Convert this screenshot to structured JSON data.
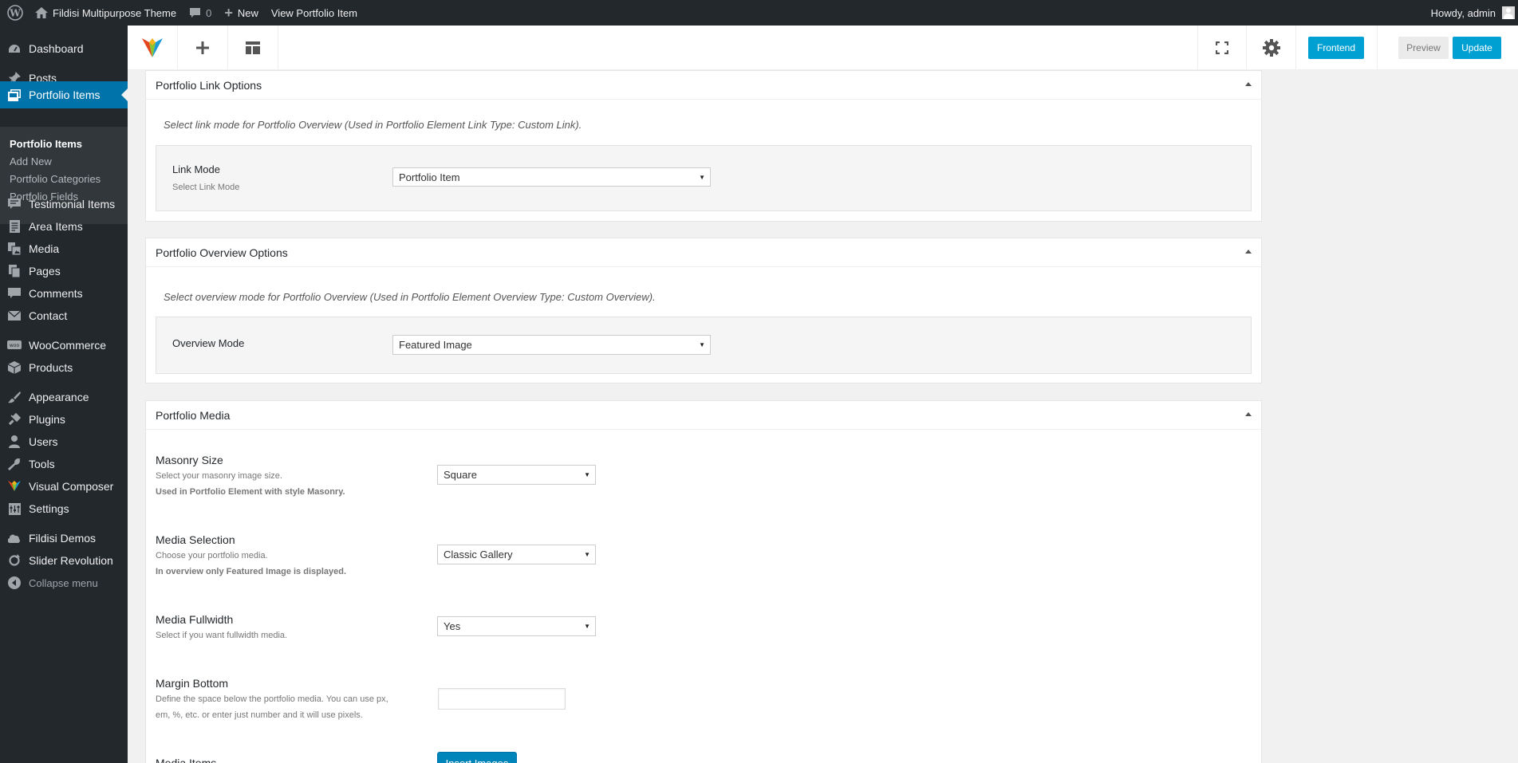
{
  "adminbar": {
    "site_name": "Fildisi Multipurpose Theme",
    "comments_count": "0",
    "new_label": "New",
    "view_label": "View Portfolio Item",
    "howdy": "Howdy, admin"
  },
  "sidebar": {
    "items": [
      {
        "label": "Dashboard",
        "icon": "dashboard-icon"
      },
      {
        "label": "Posts",
        "icon": "pin-icon"
      },
      {
        "label": "Portfolio Items",
        "icon": "portfolio-icon"
      },
      {
        "label": "Testimonial Items",
        "icon": "testimonial-icon"
      },
      {
        "label": "Area Items",
        "icon": "document-icon"
      },
      {
        "label": "Media",
        "icon": "media-icon"
      },
      {
        "label": "Pages",
        "icon": "pages-icon"
      },
      {
        "label": "Comments",
        "icon": "comment-icon"
      },
      {
        "label": "Contact",
        "icon": "mail-icon"
      },
      {
        "label": "WooCommerce",
        "icon": "woo-icon"
      },
      {
        "label": "Products",
        "icon": "box-icon"
      },
      {
        "label": "Appearance",
        "icon": "brush-icon"
      },
      {
        "label": "Plugins",
        "icon": "plugin-icon"
      },
      {
        "label": "Users",
        "icon": "user-icon"
      },
      {
        "label": "Tools",
        "icon": "wrench-icon"
      },
      {
        "label": "Visual Composer",
        "icon": "vc-icon"
      },
      {
        "label": "Settings",
        "icon": "settings-icon"
      },
      {
        "label": "Fildisi Demos",
        "icon": "cloud-icon"
      },
      {
        "label": "Slider Revolution",
        "icon": "refresh-icon"
      },
      {
        "label": "Collapse menu",
        "icon": "collapse-icon"
      }
    ],
    "submenu": [
      "Portfolio Items",
      "Add New",
      "Portfolio Categories",
      "Portfolio Fields"
    ]
  },
  "toolbar": {
    "frontend_label": "Frontend",
    "preview_label": "Preview",
    "update_label": "Update"
  },
  "link_options": {
    "title": "Portfolio Link Options",
    "description": "Select link mode for Portfolio Overview (Used in Portfolio Element Link Type: Custom Link).",
    "label": "Link Mode",
    "sublabel": "Select Link Mode",
    "value": "Portfolio Item"
  },
  "overview_options": {
    "title": "Portfolio Overview Options",
    "description": "Select overview mode for Portfolio Overview (Used in Portfolio Element Overview Type: Custom Overview).",
    "label": "Overview Mode",
    "value": "Featured Image"
  },
  "media": {
    "title": "Portfolio Media",
    "masonry": {
      "label": "Masonry Size",
      "desc1": "Select your masonry image size.",
      "desc2": "Used in Portfolio Element with style Masonry.",
      "value": "Square"
    },
    "selection": {
      "label": "Media Selection",
      "desc1": "Choose your portfolio media.",
      "desc2": "In overview only Featured Image is displayed.",
      "value": "Classic Gallery"
    },
    "fullwidth": {
      "label": "Media Fullwidth",
      "desc1": "Select if you want fullwidth media.",
      "value": "Yes"
    },
    "margin": {
      "label": "Margin Bottom",
      "desc1": "Define the space below the portfolio media. You can use px,",
      "desc2": "em, %, etc. or enter just number and it will use pixels.",
      "value": ""
    },
    "items": {
      "label": "Media Items",
      "button": "Insert Images"
    }
  },
  "colors": {
    "accent": "#0073aa",
    "button_blue": "#00a0d2",
    "sidebar_bg": "#23282d"
  }
}
